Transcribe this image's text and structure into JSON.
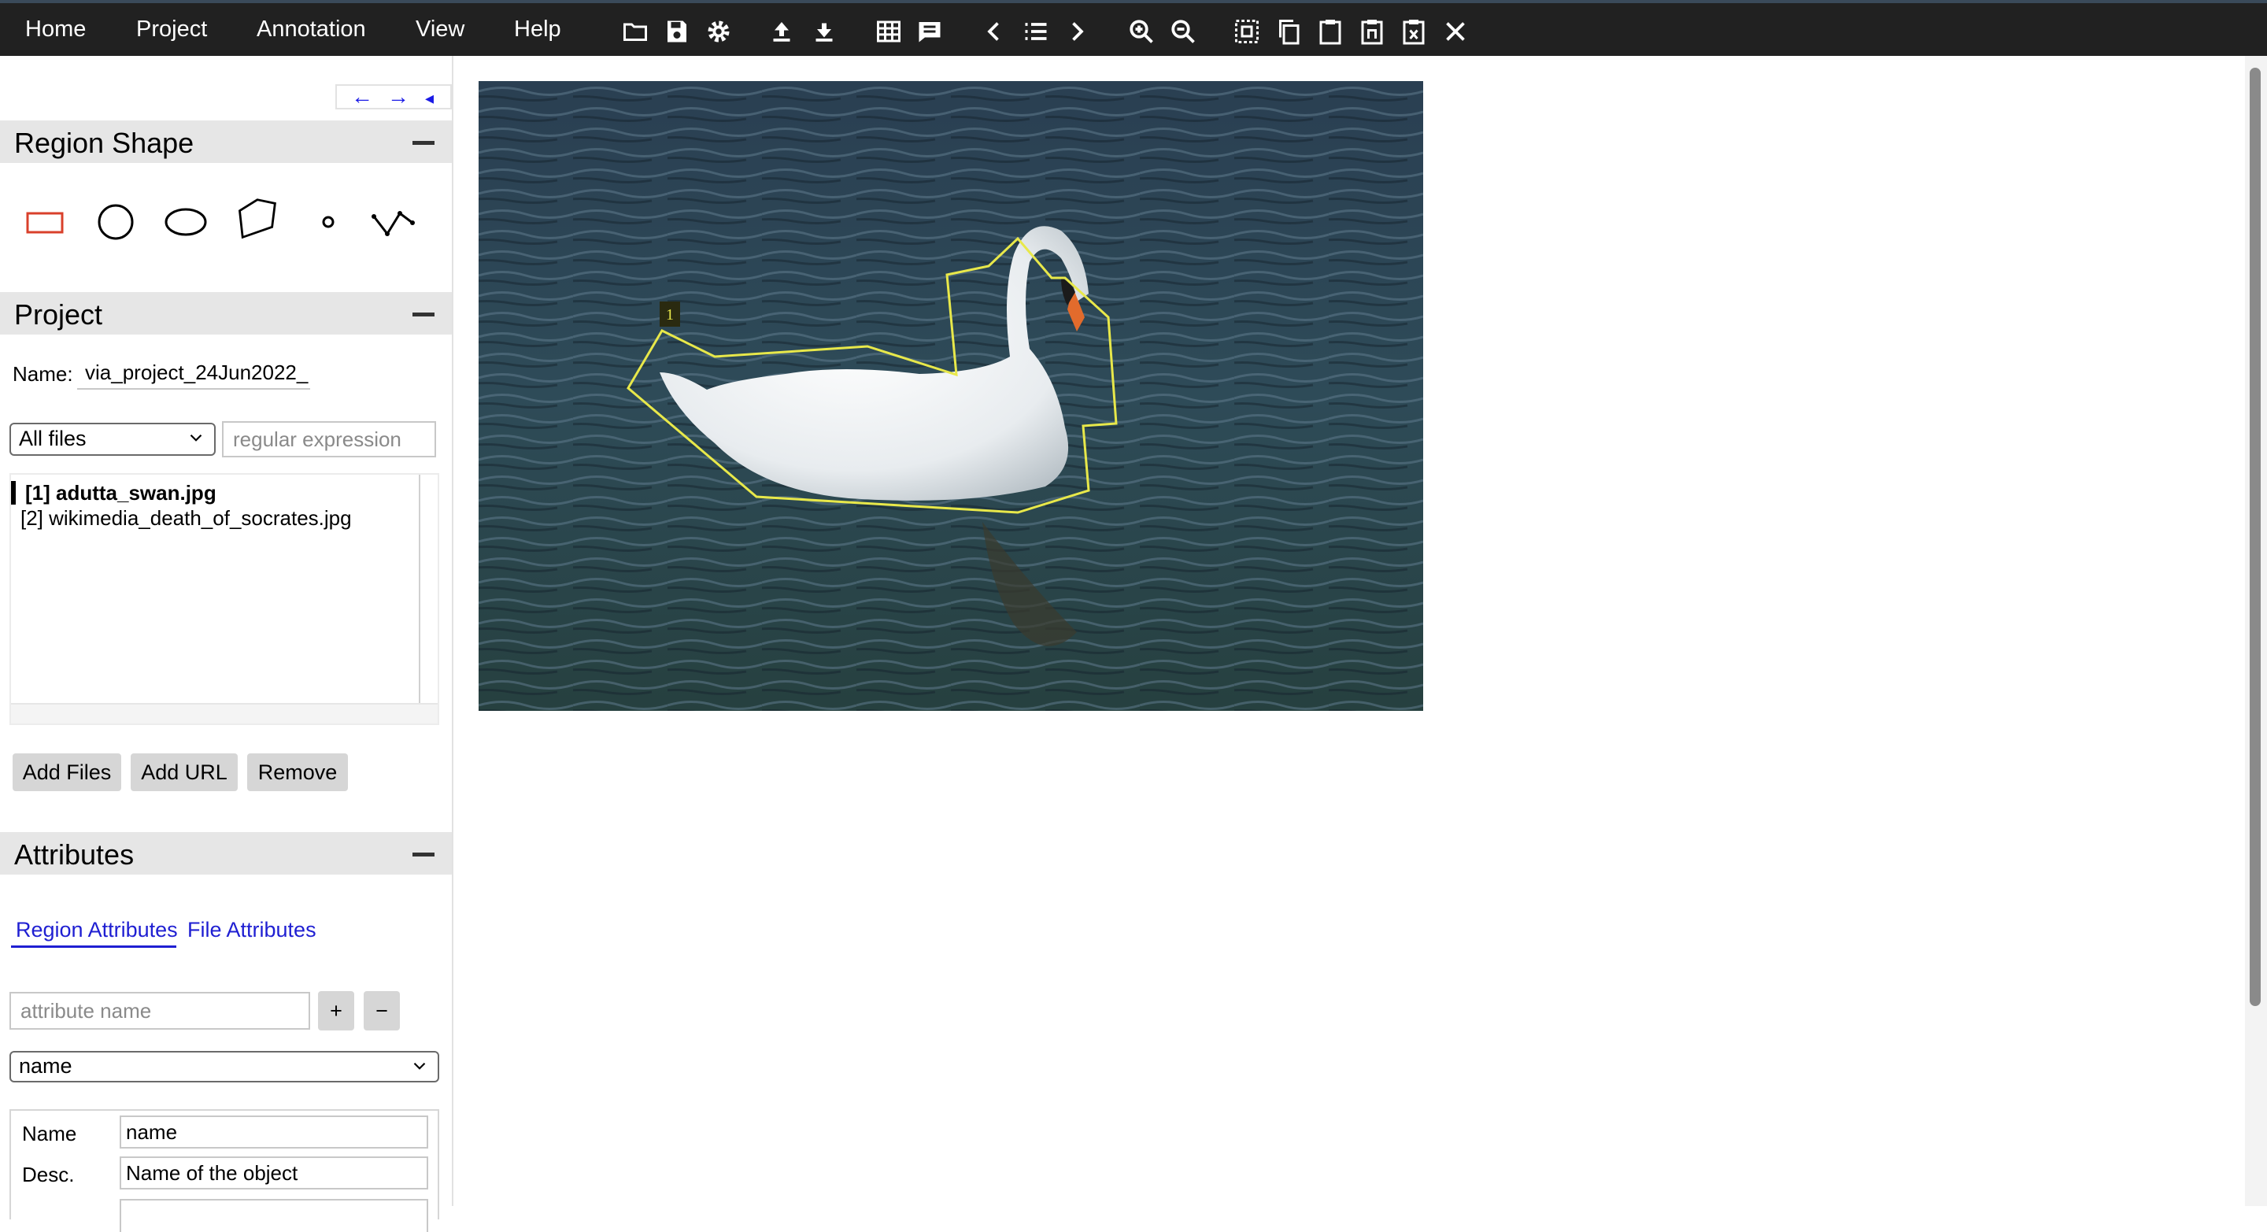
{
  "menubar": {
    "items": [
      "Home",
      "Project",
      "Annotation",
      "View",
      "Help"
    ],
    "icons": [
      "folder-open-icon",
      "save-icon",
      "gear-icon",
      "upload-icon",
      "download-icon",
      "grid-icon",
      "comment-icon",
      "chevron-left-icon",
      "list-icon",
      "chevron-right-icon",
      "zoom-in-icon",
      "zoom-out-icon",
      "select-all-icon",
      "copy-icon",
      "paste-icon",
      "paste-n-icon",
      "delete-region-icon",
      "close-icon"
    ]
  },
  "left_panel": {
    "nav": {
      "prev": "←",
      "next": "→",
      "collapse": "◂"
    },
    "region_shape": {
      "title": "Region Shape",
      "shapes": [
        "rectangle-shape-icon",
        "circle-shape-icon",
        "ellipse-shape-icon",
        "polygon-shape-icon",
        "point-shape-icon",
        "polyline-shape-icon"
      ],
      "selected_color": "#d9402b"
    },
    "project": {
      "title": "Project",
      "name_label": "Name:",
      "name_value": "via_project_24Jun2022_",
      "filter_select": "All files",
      "filter_placeholder": "regular expression",
      "files": [
        "[1] adutta_swan.jpg",
        "[2] wikimedia_death_of_socrates.jpg"
      ],
      "buttons": {
        "add_files": "Add Files",
        "add_url": "Add URL",
        "remove": "Remove"
      }
    },
    "attributes": {
      "title": "Attributes",
      "tabs": [
        "Region Attributes",
        "File Attributes"
      ],
      "attribute_name_placeholder": "attribute name",
      "add_label": "+",
      "remove_label": "−",
      "selected_attribute": "name",
      "fields": [
        {
          "label": "Name",
          "value": "name"
        },
        {
          "label": "Desc.",
          "value": "Name of the object"
        }
      ]
    }
  },
  "image_view": {
    "region_label": "1",
    "region_color": "#e8e84a"
  }
}
